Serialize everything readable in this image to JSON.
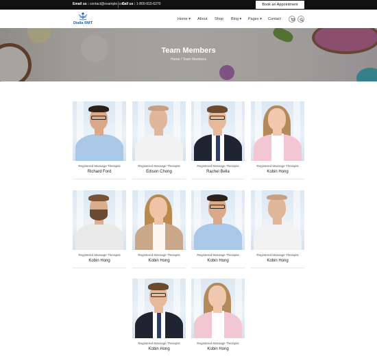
{
  "topbar": {
    "email_label": "Email us :",
    "email_value": "contact@example.com",
    "call_label": "Call us :",
    "call_value": "1-800-915-6270",
    "appointment_button": "Book an Appointment"
  },
  "brand": {
    "name": "Dialla RMT",
    "logo_color": "#1a5fa8"
  },
  "nav": {
    "items": [
      {
        "label": "Home",
        "has_dropdown": true
      },
      {
        "label": "About",
        "has_dropdown": false
      },
      {
        "label": "Shop",
        "has_dropdown": false
      },
      {
        "label": "Blog",
        "has_dropdown": true
      },
      {
        "label": "Pages",
        "has_dropdown": true
      },
      {
        "label": "Contact",
        "has_dropdown": false
      }
    ],
    "cart_icon": "cart-icon",
    "search_icon": "search-icon"
  },
  "hero": {
    "title": "Team Members",
    "breadcrumb_home": "Home",
    "breadcrumb_separator": "/",
    "breadcrumb_current": "Team Members"
  },
  "team": {
    "members": [
      {
        "role": "Registered Massage Therapist",
        "name": "Richard Ford"
      },
      {
        "role": "Registered Massage Therapist",
        "name": "Edison Chong"
      },
      {
        "role": "Registered Massage Therapist",
        "name": "Rachel Bella"
      },
      {
        "role": "Registered Massage Therapist",
        "name": "Kobin Hong"
      },
      {
        "role": "Registered Massage Therapist",
        "name": "Kobin Hong"
      },
      {
        "role": "Registered Massage Therapist",
        "name": "Kobin Hong"
      },
      {
        "role": "Registered Massage Therapist",
        "name": "Kobin Hong"
      },
      {
        "role": "Registered Massage Therapist",
        "name": "Kobin Hong"
      },
      {
        "role": "Registered Massage Therapist",
        "name": "Kobin Hong"
      },
      {
        "role": "Registered Massage Therapist",
        "name": "Kobin Hong"
      }
    ]
  }
}
